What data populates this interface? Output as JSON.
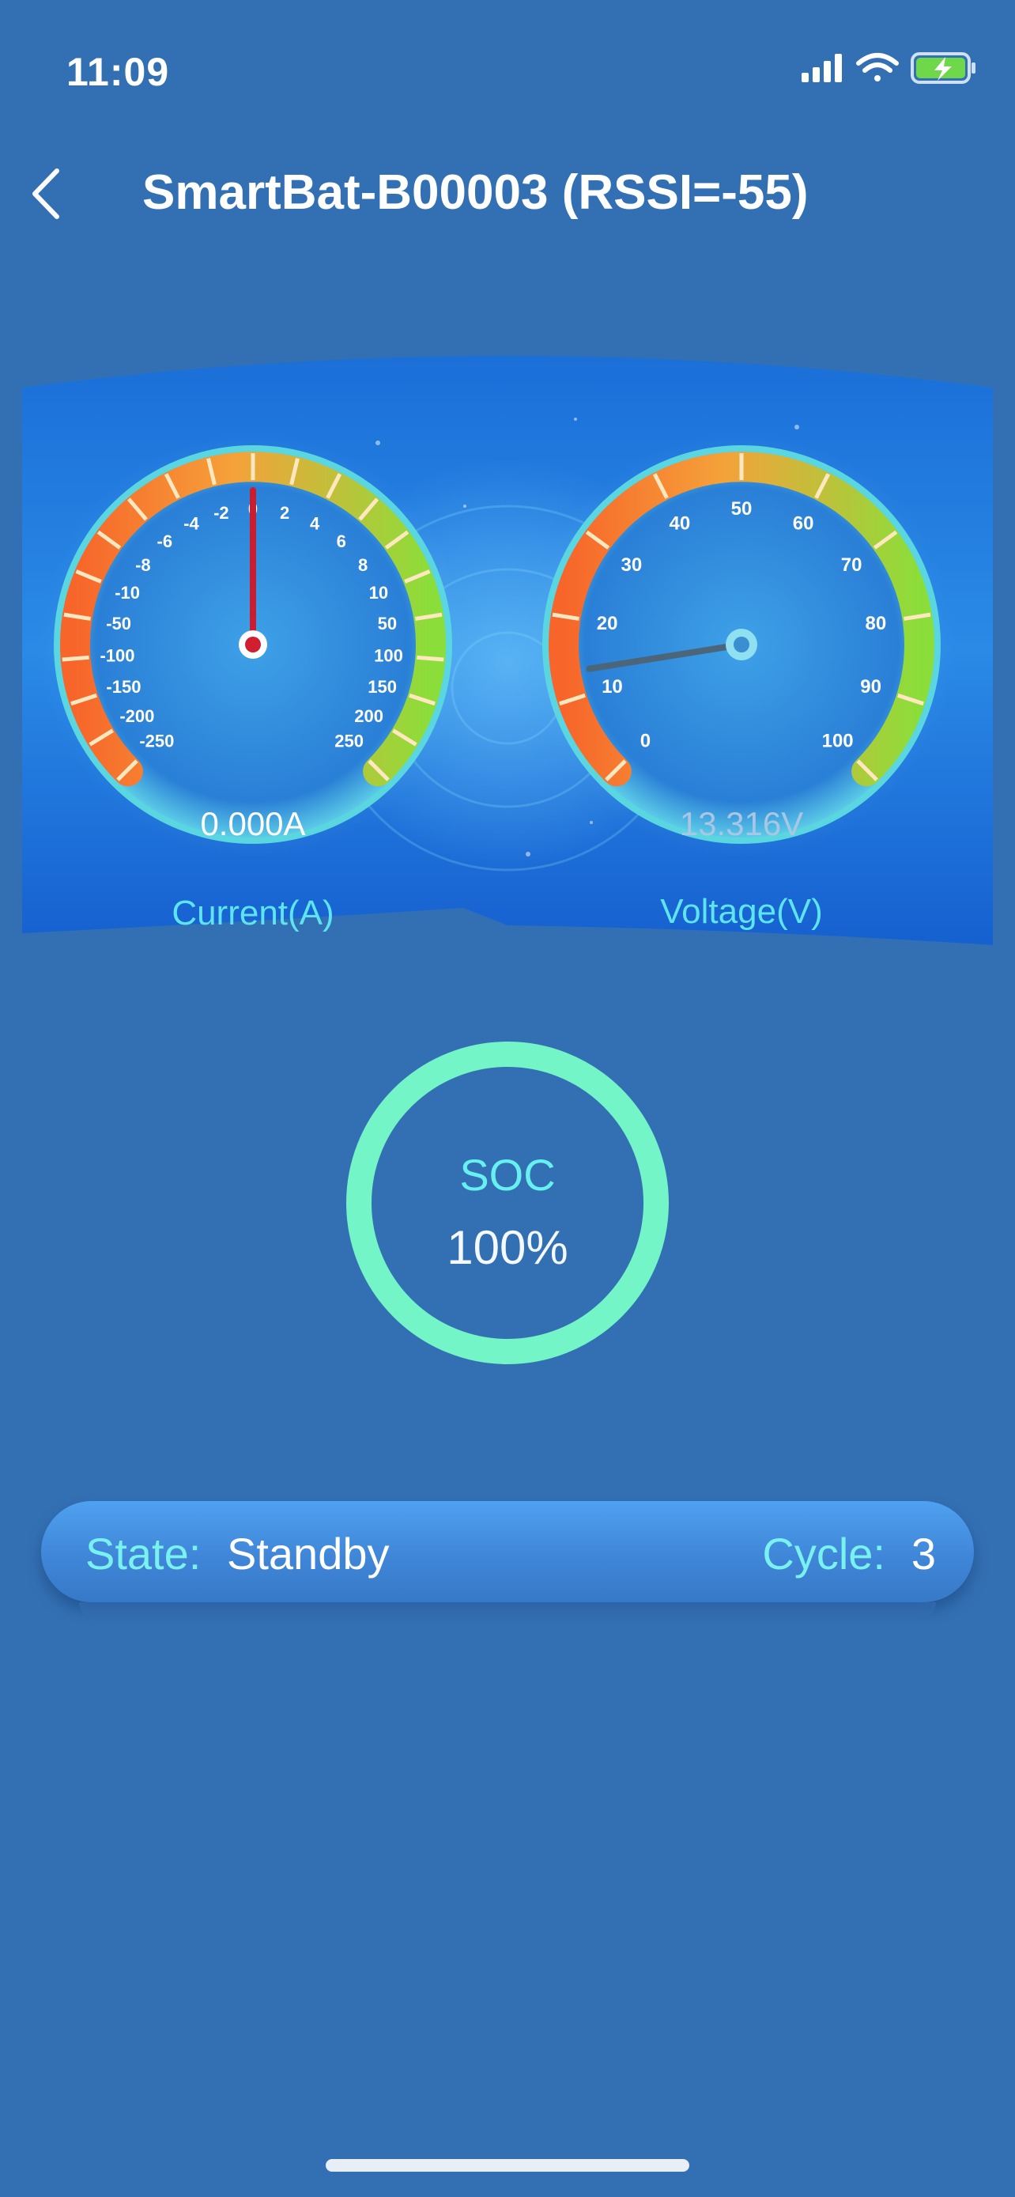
{
  "status_bar": {
    "time": "11:09",
    "battery": "charging"
  },
  "nav": {
    "title": "SmartBat-B00003 (RSSI=-55)"
  },
  "current_gauge": {
    "label": "Current(A)",
    "reading": "0.000A",
    "value": 0,
    "ticks": [
      "-250",
      "-200",
      "-150",
      "-100",
      "-50",
      "-10",
      "-8",
      "-6",
      "-4",
      "-2",
      "0",
      "2",
      "4",
      "6",
      "8",
      "10",
      "50",
      "100",
      "150",
      "200",
      "250"
    ]
  },
  "voltage_gauge": {
    "label": "Voltage(V)",
    "reading": "13.316V",
    "value": 13.316,
    "ticks": [
      "0",
      "10",
      "20",
      "30",
      "40",
      "50",
      "60",
      "70",
      "80",
      "90",
      "100"
    ]
  },
  "soc": {
    "title": "SOC",
    "value": "100%",
    "percent": 100
  },
  "info": {
    "state_label": "State:",
    "state_value": "Standby",
    "cycle_label": "Cycle:",
    "cycle_value": "3"
  },
  "colors": {
    "background": "#3370b3",
    "accent": "#79f1ee",
    "soc_ring": "#74f5c8",
    "gauge_low": "#f7652a",
    "gauge_high": "#8bde3a"
  }
}
